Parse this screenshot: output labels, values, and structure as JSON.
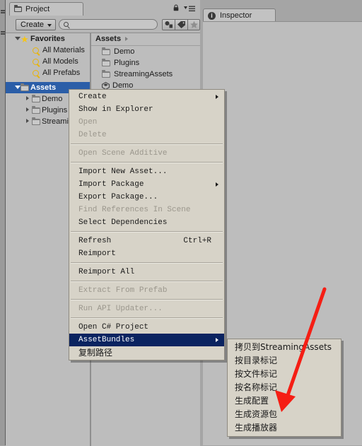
{
  "window": {
    "toolbar_buttons": [
      "toolbar-button-1",
      "toolbar-button-2",
      "toolbar-button-3"
    ]
  },
  "project_panel": {
    "tab_label": "Project",
    "tab_icon": "folder-icon",
    "lock_icon": "lock-icon",
    "menu_icon": "hamburger-menu-icon",
    "toolbar": {
      "create_label": "Create",
      "create_caret_icon": "chevron-down-icon",
      "search_placeholder": "",
      "search_value": "",
      "search_icon": "search-icon",
      "filter_icon": "filter-by-type-icon",
      "label_icon": "label-tag-icon",
      "star_icon": "favorite-star-icon"
    },
    "tree": {
      "favorites": {
        "label": "Favorites",
        "icon": "star-icon",
        "expander": "triangle-open-icon",
        "children": [
          {
            "label": "All Materials",
            "icon": "search-icon"
          },
          {
            "label": "All Models",
            "icon": "search-icon"
          },
          {
            "label": "All Prefabs",
            "icon": "search-icon"
          }
        ]
      },
      "assets": {
        "label": "Assets",
        "icon": "folder-icon",
        "expander": "triangle-open-icon",
        "selected": true,
        "children": [
          {
            "label": "Demo",
            "icon": "folder-icon",
            "expander": "triangle-closed-icon"
          },
          {
            "label": "Plugins",
            "icon": "folder-icon",
            "expander": "triangle-closed-icon"
          },
          {
            "label": "StreamingAssets",
            "icon": "folder-icon",
            "expander": "triangle-closed-icon"
          }
        ]
      }
    },
    "list": {
      "header_label": "Assets",
      "header_arrow_icon": "triangle-right-icon",
      "items": [
        {
          "label": "Demo",
          "icon": "folder-icon"
        },
        {
          "label": "Plugins",
          "icon": "folder-icon"
        },
        {
          "label": "StreamingAssets",
          "icon": "folder-icon"
        },
        {
          "label": "Demo",
          "icon": "unity-scene-icon"
        }
      ]
    }
  },
  "inspector_panel": {
    "tab_label": "Inspector",
    "tab_icon": "info-icon",
    "info_glyph": "i"
  },
  "context_menu": {
    "items": [
      {
        "label": "Create",
        "state": "normal",
        "submenu": true
      },
      {
        "label": "Show in Explorer",
        "state": "normal"
      },
      {
        "label": "Open",
        "state": "disabled"
      },
      {
        "label": "Delete",
        "state": "disabled"
      },
      {
        "separator": true
      },
      {
        "label": "Open Scene Additive",
        "state": "disabled"
      },
      {
        "separator": true
      },
      {
        "label": "Import New Asset...",
        "state": "normal"
      },
      {
        "label": "Import Package",
        "state": "normal",
        "submenu": true
      },
      {
        "label": "Export Package...",
        "state": "normal"
      },
      {
        "label": "Find References In Scene",
        "state": "disabled"
      },
      {
        "label": "Select Dependencies",
        "state": "normal"
      },
      {
        "separator": true
      },
      {
        "label": "Refresh",
        "state": "normal",
        "shortcut": "Ctrl+R"
      },
      {
        "label": "Reimport",
        "state": "normal"
      },
      {
        "separator": true
      },
      {
        "label": "Reimport All",
        "state": "normal"
      },
      {
        "separator": true
      },
      {
        "label": "Extract From Prefab",
        "state": "disabled"
      },
      {
        "separator": true
      },
      {
        "label": "Run API Updater...",
        "state": "disabled"
      },
      {
        "separator": true
      },
      {
        "label": "Open C# Project",
        "state": "normal"
      },
      {
        "label": "AssetBundles",
        "state": "highlighted",
        "submenu": true
      },
      {
        "label": "复制路径",
        "state": "normal",
        "cjk": true
      }
    ]
  },
  "asset_bundles_submenu": {
    "items": [
      {
        "label": "拷贝到StreamingAssets"
      },
      {
        "label": "按目录标记"
      },
      {
        "label": "按文件标记"
      },
      {
        "label": "按名称标记"
      },
      {
        "label": "生成配置"
      },
      {
        "label": "生成资源包"
      },
      {
        "label": "生成播放器"
      }
    ]
  },
  "annotation": {
    "arrow_color": "#f51e14",
    "arrow_target": "生成资源包"
  },
  "colors": {
    "panel_bg": "#bdbdbd",
    "window_bg": "#a5a5a5",
    "menu_bg": "#d7d3c8",
    "menu_highlight": "#0a2360",
    "tree_selected": "#2b5ea8",
    "accent_red": "#f51e14"
  }
}
